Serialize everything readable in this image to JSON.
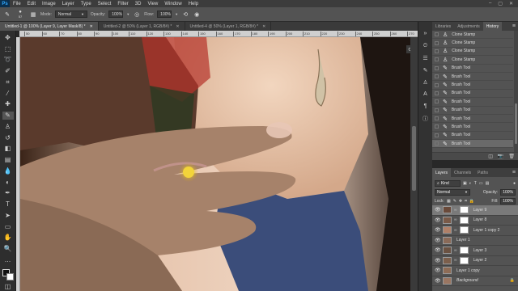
{
  "menubar": {
    "app_logo": "Ps",
    "items": [
      "File",
      "Edit",
      "Image",
      "Layer",
      "Type",
      "Select",
      "Filter",
      "3D",
      "View",
      "Window",
      "Help"
    ]
  },
  "options": {
    "brush_size": "57",
    "mode_label": "Mode:",
    "mode_value": "Normal",
    "opacity_label": "Opacity:",
    "opacity_value": "100%",
    "flow_label": "Flow:",
    "flow_value": "100%"
  },
  "doc_tabs": [
    {
      "label": "Untitled-1 @ 100% (Layer 9, Layer Mask/8) *"
    },
    {
      "label": "Untitled-2 @ 50% (Layer 1, RGB/8#) *"
    },
    {
      "label": "Untitled-4 @ 50% (Layer 1, RGB/8#) *"
    }
  ],
  "ruler": {
    "ticks": [
      "50",
      "60",
      "70",
      "80",
      "90",
      "100",
      "110",
      "120",
      "130",
      "140",
      "150",
      "160",
      "170",
      "180",
      "190",
      "200",
      "210",
      "220",
      "230",
      "240",
      "250",
      "260",
      "270"
    ]
  },
  "history": {
    "tabs": [
      "Libraries",
      "Adjustments",
      "History"
    ],
    "items": [
      {
        "label": "Clone Stamp",
        "selected": false
      },
      {
        "label": "Clone Stamp",
        "selected": false
      },
      {
        "label": "Clone Stamp",
        "selected": false
      },
      {
        "label": "Clone Stamp",
        "selected": false
      },
      {
        "label": "Brush Tool",
        "selected": false
      },
      {
        "label": "Brush Tool",
        "selected": false
      },
      {
        "label": "Brush Tool",
        "selected": false
      },
      {
        "label": "Brush Tool",
        "selected": false
      },
      {
        "label": "Brush Tool",
        "selected": false
      },
      {
        "label": "Brush Tool",
        "selected": false
      },
      {
        "label": "Brush Tool",
        "selected": false
      },
      {
        "label": "Brush Tool",
        "selected": false
      },
      {
        "label": "Brush Tool",
        "selected": false
      },
      {
        "label": "Brush Tool",
        "selected": true
      }
    ]
  },
  "layers_panel": {
    "tabs": [
      "Layers",
      "Channels",
      "Paths"
    ],
    "kind_label": "Kind",
    "blend_mode": "Normal",
    "opacity_label": "Opacity:",
    "opacity_value": "100%",
    "lock_label": "Lock:",
    "fill_label": "Fill:",
    "fill_value": "100%",
    "layers": [
      {
        "name": "Layer 9",
        "mask": "white",
        "selected": true
      },
      {
        "name": "Layer 8",
        "mask": "white",
        "selected": false
      },
      {
        "name": "Layer 1 copy 2",
        "mask": "white",
        "selected": false
      },
      {
        "name": "Layer 1",
        "mask": "none",
        "selected": false
      },
      {
        "name": "Layer 3",
        "mask": "white",
        "selected": false
      },
      {
        "name": "Layer 2",
        "mask": "white",
        "selected": false
      },
      {
        "name": "Layer 1 copy",
        "mask": "none",
        "selected": false
      },
      {
        "name": "Background",
        "mask": "none",
        "selected": false
      }
    ]
  }
}
